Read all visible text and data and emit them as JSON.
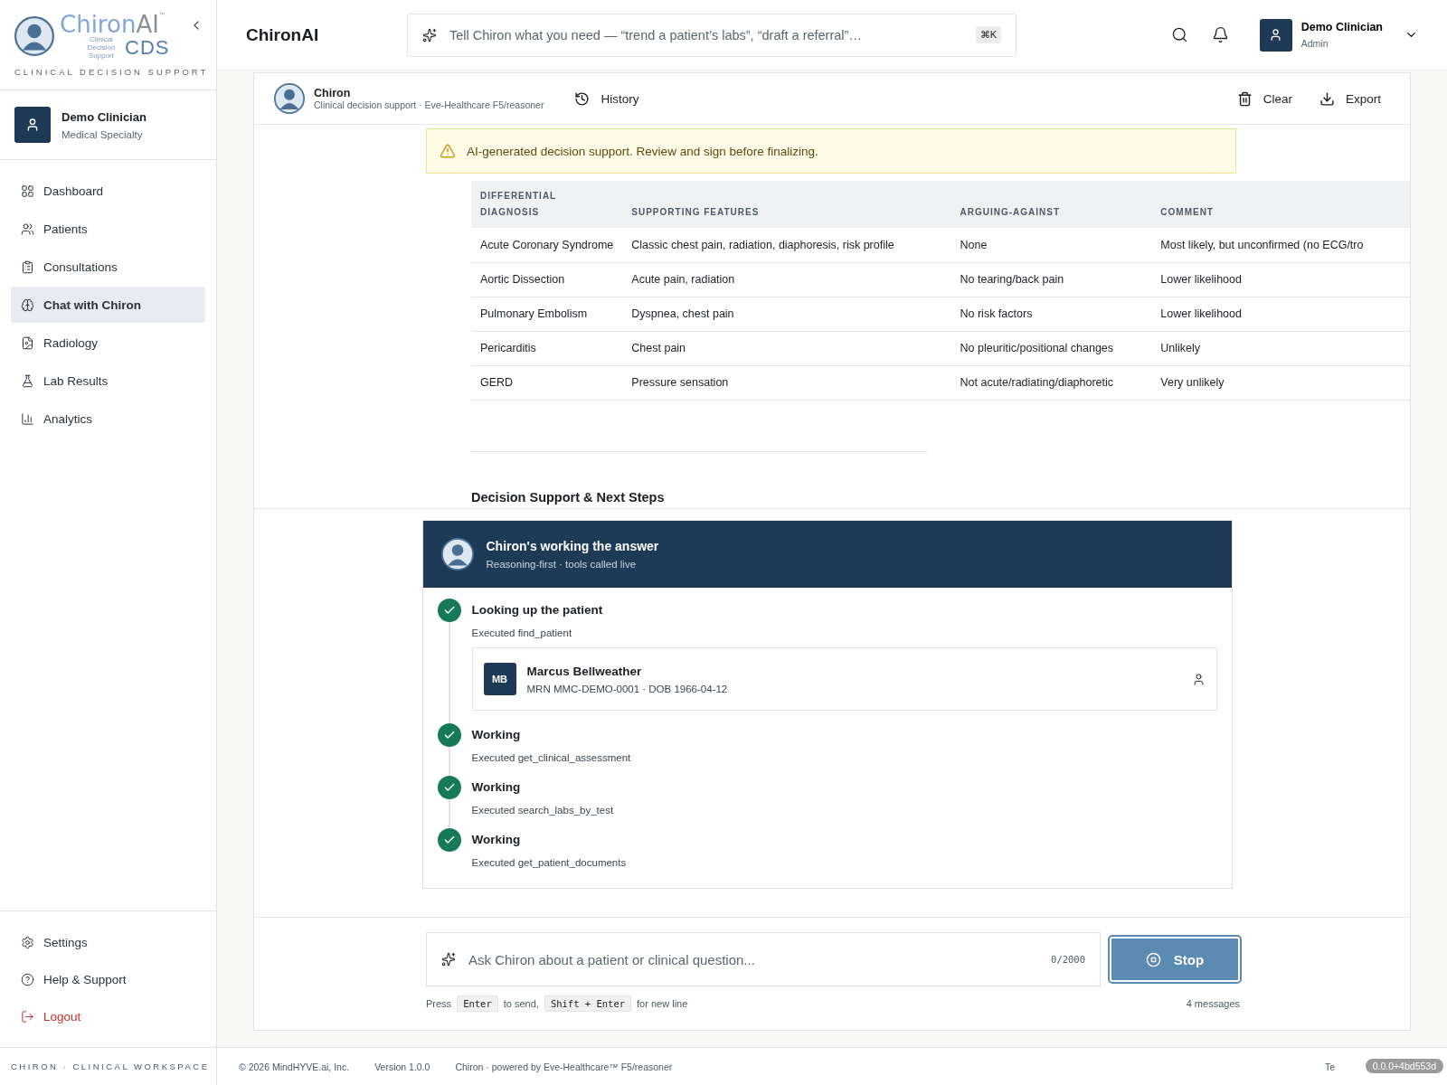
{
  "brand": {
    "logo_main": "Chiron",
    "logo_ai": "AI",
    "logo_tm": "™",
    "logo_cds": "CDS",
    "logo_small": "Clinical Decision Support",
    "tagline": "CLINICAL DECISION SUPPORT"
  },
  "sidebar_user": {
    "name": "Demo Clinician",
    "role": "Medical Specialty"
  },
  "nav": [
    {
      "label": "Dashboard",
      "selected": false
    },
    {
      "label": "Patients",
      "selected": false
    },
    {
      "label": "Consultations",
      "selected": false
    },
    {
      "label": "Chat with Chiron",
      "selected": true
    },
    {
      "label": "Radiology",
      "selected": false
    },
    {
      "label": "Lab Results",
      "selected": false
    },
    {
      "label": "Analytics",
      "selected": false
    }
  ],
  "bottom_nav": [
    {
      "label": "Settings",
      "kind": "settings"
    },
    {
      "label": "Help & Support",
      "kind": "help"
    },
    {
      "label": "Logout",
      "kind": "logout"
    }
  ],
  "sidebar_footer": "CHIRON · CLINICAL WORKSPACE",
  "header": {
    "title": "ChironAI",
    "command_placeholder": "Tell Chiron what you need — “trend a patient’s labs”, “draft a referral”…",
    "shortcut": "⌘K",
    "user_name": "Demo Clinician",
    "user_role": "Admin"
  },
  "chat_header": {
    "name": "Chiron",
    "subtitle": "Clinical decision support · Eve-Healthcare F5/reasoner",
    "history": "History",
    "clear": "Clear",
    "export": "Export"
  },
  "warning": "AI-generated decision support. Review and sign before finalizing.",
  "table": {
    "columns": [
      "DIFFERENTIAL DIAGNOSIS",
      "SUPPORTING FEATURES",
      "ARGUING-AGAINST",
      "COMMENT"
    ],
    "rows": [
      [
        "Acute Coronary Syndrome",
        "Classic chest pain, radiation, diaphoresis, risk profile",
        "None",
        "Most likely, but unconfirmed (no ECG/tro"
      ],
      [
        "Aortic Dissection",
        "Acute pain, radiation",
        "No tearing/back pain",
        "Lower likelihood"
      ],
      [
        "Pulmonary Embolism",
        "Dyspnea, chest pain",
        "No risk factors",
        "Lower likelihood"
      ],
      [
        "Pericarditis",
        "Chest pain",
        "No pleuritic/positional changes",
        "Unlikely"
      ],
      [
        "GERD",
        "Pressure sensation",
        "Not acute/radiating/diaphoretic",
        "Very unlikely"
      ]
    ]
  },
  "section_heading": "Decision Support & Next Steps",
  "working": {
    "title": "Chiron's working the answer",
    "subtitle": "Reasoning-first · tools called live",
    "steps": [
      {
        "title": "Looking up the patient",
        "detail": "Executed find_patient",
        "done": true,
        "patient": {
          "initials": "MB",
          "name": "Marcus Bellweather",
          "meta": "MRN MMC-DEMO-0001 · DOB 1966-04-12"
        }
      },
      {
        "title": "Working",
        "detail": "Executed get_clinical_assessment",
        "done": true
      },
      {
        "title": "Working",
        "detail": "Executed search_labs_by_test",
        "done": true
      },
      {
        "title": "Working",
        "detail": "Executed get_patient_documents",
        "done": true
      }
    ]
  },
  "composer": {
    "placeholder": "Ask Chiron about a patient or clinical question...",
    "counter": "0/2000",
    "stop": "Stop",
    "hint_press": "Press",
    "key_enter": "Enter",
    "hint_send": "to send,",
    "key_shift": "Shift + Enter",
    "hint_newline": "for new line",
    "messages": "4 messages"
  },
  "footer": {
    "copyright": "© 2026 MindHYVE.ai, Inc.",
    "version": "Version 1.0.0",
    "powered": "Chiron · powered by Eve-Healthcare™ F5/reasoner",
    "right": "Te",
    "build": "0.0.0+4bd553d"
  }
}
